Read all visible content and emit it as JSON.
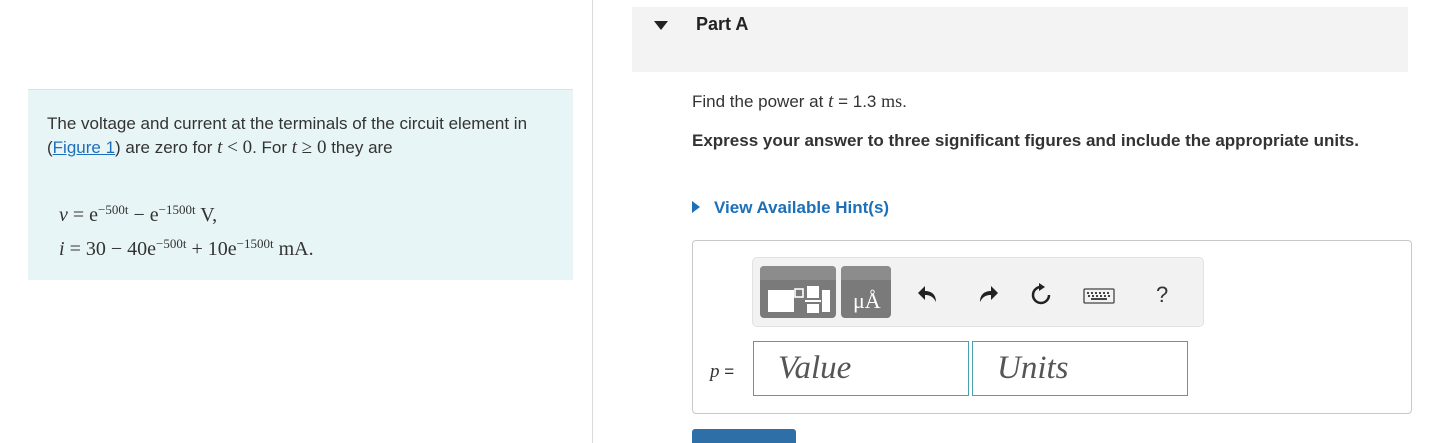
{
  "problem": {
    "text_before_link": "The voltage and current at the terminals of the circuit element in (",
    "figure_link": "Figure 1",
    "text_after_link": ") are zero for ",
    "cond1_var": "t",
    "cond1_rel": " < 0",
    "text_mid": ". For ",
    "cond2_var": "t",
    "cond2_rel": " ≥ 0",
    "text_end": " they are",
    "eq_v": {
      "lhs": "v",
      "eq": " = e",
      "exp1": "−500t",
      "mid": " − e",
      "exp2": "−1500t",
      "unit": " V,"
    },
    "eq_i": {
      "lhs": "i",
      "eq": " = 30 − 40e",
      "exp1": "−500t",
      "mid": " + 10e",
      "exp2": "−1500t",
      "unit": " mA."
    }
  },
  "part": {
    "title": "Part A",
    "question_prefix": "Find the power at ",
    "question_var": "t",
    "question_eq": " = 1.3 ",
    "question_unit": "ms",
    "question_end": ".",
    "instruction": "Express your answer to three significant figures and include the appropriate units.",
    "hints_label": "View Available Hint(s)"
  },
  "answer": {
    "var_label": "p",
    "eq_sign": " =",
    "value_placeholder": "Value",
    "units_placeholder": "Units",
    "toolbar": {
      "templates_icon": "templates-icon",
      "units_icon": "units-icon",
      "units_glyph": "μÅ",
      "undo_icon": "undo-icon",
      "redo_icon": "redo-icon",
      "reset_icon": "reset-icon",
      "keyboard_icon": "keyboard-icon",
      "help_label": "?"
    }
  },
  "colors": {
    "problem_bg": "#e8f5f6",
    "link": "#1d6fb8",
    "field_border": "#4ba1ab",
    "header_bg": "#f3f3f3",
    "submit": "#2f6fa8"
  }
}
